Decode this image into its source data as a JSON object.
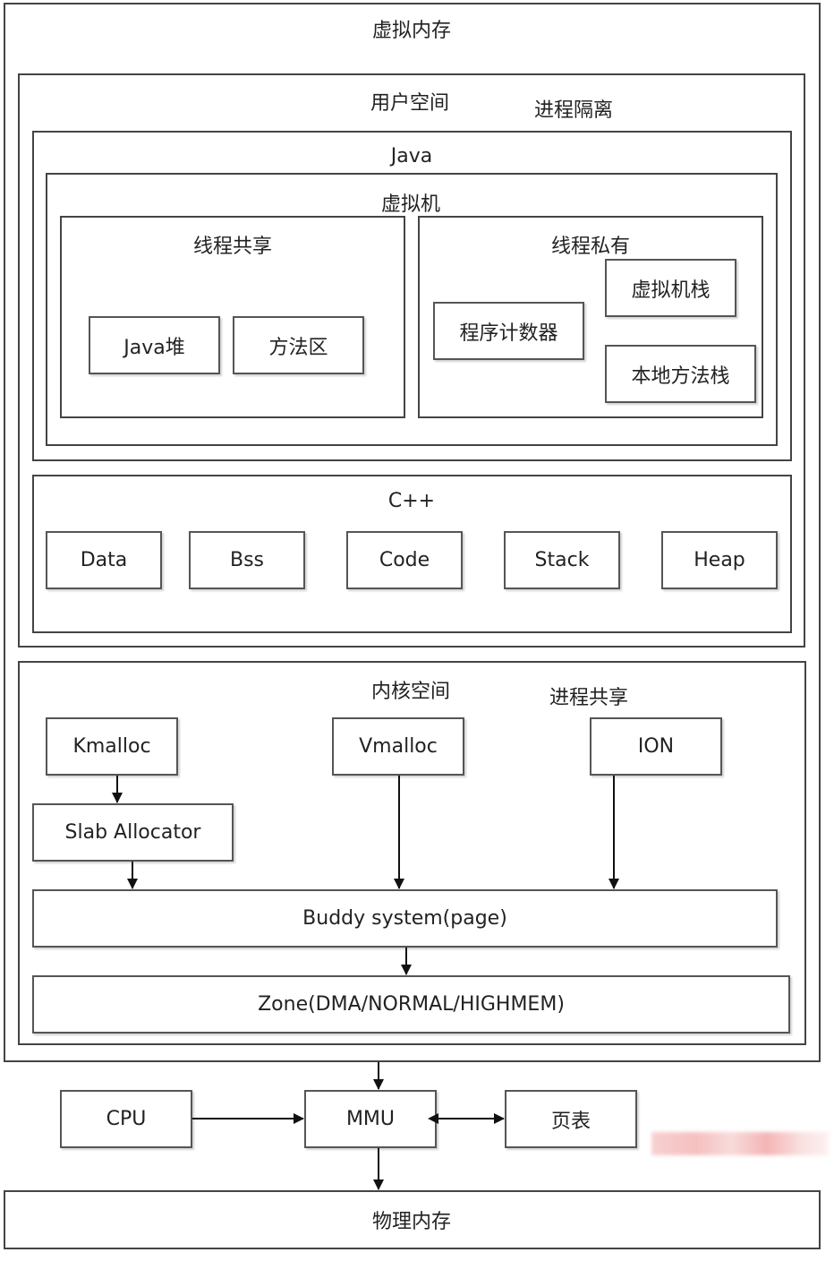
{
  "virtual_memory": {
    "title": "虚拟内存"
  },
  "user_space": {
    "title": "用户空间",
    "note": "进程隔离"
  },
  "java": {
    "title": "Java",
    "vm": {
      "title": "虚拟机",
      "shared": {
        "title": "线程共享",
        "items": [
          "Java堆",
          "方法区"
        ]
      },
      "private": {
        "title": "线程私有",
        "items": [
          "程序计数器",
          "虚拟机栈",
          "本地方法栈"
        ]
      }
    }
  },
  "cpp": {
    "title": "C++",
    "items": [
      "Data",
      "Bss",
      "Code",
      "Stack",
      "Heap"
    ]
  },
  "kernel_space": {
    "title": "内核空间",
    "note": "进程共享",
    "kmalloc": "Kmalloc",
    "vmalloc": "Vmalloc",
    "ion": "ION",
    "slab": "Slab Allocator",
    "buddy": "Buddy system(page)",
    "zone": "Zone(DMA/NORMAL/HIGHMEM)"
  },
  "hardware": {
    "cpu": "CPU",
    "mmu": "MMU",
    "page_table": "页表"
  },
  "physical_memory": {
    "title": "物理内存"
  },
  "colors": {
    "border": "#444444",
    "node_border": "#555555",
    "arrow": "#111111",
    "watermark": "#f2a3a3"
  }
}
